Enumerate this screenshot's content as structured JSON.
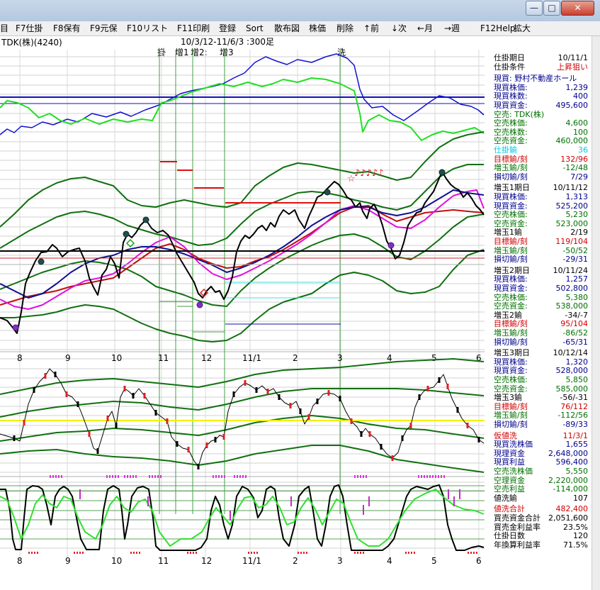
{
  "window": {
    "buttons": [
      "—",
      "□",
      "✕"
    ]
  },
  "menu": [
    "目",
    "F7仕掛",
    "F8保有",
    "F9元保",
    "F10リスト",
    "F11印刷",
    "登録",
    "Sort",
    "散布図",
    "株価",
    "削除",
    "↑前",
    "↓次",
    "←月",
    "→週",
    "F12Help",
    "拡大"
  ],
  "chart": {
    "stock": "TDK(株)(4240)",
    "range": "10/3/12-11/6/3 :300足",
    "markers": [
      "掛",
      "增1",
      "增2:",
      "增3",
      "洗"
    ],
    "x_ticks_main": [
      "8",
      "9",
      "10",
      "11",
      "12",
      "11/1",
      "2",
      "3",
      "4",
      "5",
      "6"
    ],
    "x_ticks_bottom": [
      "8",
      "9",
      "10",
      "11",
      "12",
      "11/1",
      "2",
      "3",
      "4",
      "5",
      "6"
    ],
    "notes": "♪♪♪♪♪",
    "star": "☆"
  },
  "panel": {
    "rows": [
      {
        "label": "仕掛期日",
        "value": "10/11/1",
        "color": "#000000"
      },
      {
        "label": "仕掛条件",
        "value": "上昇狙い",
        "color": "#000000",
        "vcolor": "#d00000"
      },
      {
        "label": "",
        "value": "",
        "gap": true
      },
      {
        "label": "現買: 野村不動産ホール",
        "value": "",
        "color": "#00008b"
      },
      {
        "label": "現買株価:",
        "value": "1,239",
        "color": "#00008b"
      },
      {
        "label": "現買株数:",
        "value": "400",
        "color": "#00008b"
      },
      {
        "label": "現買資金:",
        "value": "495,600",
        "color": "#00008b"
      },
      {
        "label": "空売: TDK(株)",
        "value": "",
        "color": "#007000"
      },
      {
        "label": "空売株価:",
        "value": "4,600",
        "color": "#007000"
      },
      {
        "label": "空売株数:",
        "value": "100",
        "color": "#007000"
      },
      {
        "label": "空売資金:",
        "value": "460,000",
        "color": "#007000"
      },
      {
        "label": "仕掛鍮",
        "value": "36",
        "color": "#00c8e6"
      },
      {
        "label": "目標鍮/刻",
        "value": "132/96",
        "color": "#d00000"
      },
      {
        "label": "増玉鍮/刻",
        "value": "-12/48",
        "color": "#007000"
      },
      {
        "label": "損切鍮/刻",
        "value": "7/29",
        "color": "#00008b"
      },
      {
        "label": "",
        "value": "",
        "gap": true
      },
      {
        "label": "増玉1期日",
        "value": "10/11/12",
        "color": "#000000"
      },
      {
        "label": "現買株価:",
        "value": "1,313",
        "color": "#00008b"
      },
      {
        "label": "現買資金:",
        "value": "525,200",
        "color": "#00008b"
      },
      {
        "label": "空売株価:",
        "value": "5,230",
        "color": "#007000"
      },
      {
        "label": "空売資金:",
        "value": "523,000",
        "color": "#007000"
      },
      {
        "label": "増玉1鍮",
        "value": "2/19",
        "color": "#000000"
      },
      {
        "label": "目標鍮/刻",
        "value": "119/104",
        "color": "#d00000"
      },
      {
        "label": "増玉鍮/刻",
        "value": "-50/52",
        "color": "#007000"
      },
      {
        "label": "損切鍮/刻",
        "value": "-29/31",
        "color": "#00008b"
      },
      {
        "label": "",
        "value": "",
        "gap": true
      },
      {
        "label": "増玉2期日",
        "value": "10/11/24",
        "color": "#000000"
      },
      {
        "label": "現買株価:",
        "value": "1,257",
        "color": "#00008b"
      },
      {
        "label": "現買資金:",
        "value": "502,800",
        "color": "#00008b"
      },
      {
        "label": "空売株価:",
        "value": "5,380",
        "color": "#007000"
      },
      {
        "label": "空売資金:",
        "value": "538,000",
        "color": "#007000"
      },
      {
        "label": "増玉2鍮",
        "value": "-34/-7",
        "color": "#000000"
      },
      {
        "label": "目標鍮/刻",
        "value": "95/104",
        "color": "#d00000"
      },
      {
        "label": "増玉鍮/刻",
        "value": "-86/52",
        "color": "#007000"
      },
      {
        "label": "損切鍮/刻",
        "value": "-65/31",
        "color": "#00008b"
      },
      {
        "label": "",
        "value": "",
        "gap": true
      },
      {
        "label": "増玉3期日",
        "value": "10/12/14",
        "color": "#000000"
      },
      {
        "label": "現買株価:",
        "value": "1,320",
        "color": "#00008b"
      },
      {
        "label": "現買資金:",
        "value": "528,000",
        "color": "#00008b"
      },
      {
        "label": "空売株価:",
        "value": "5,850",
        "color": "#007000"
      },
      {
        "label": "空売資金:",
        "value": "585,000",
        "color": "#007000"
      },
      {
        "label": "増玉3鍮",
        "value": "-56/-31",
        "color": "#000000"
      },
      {
        "label": "目標鍮/刻",
        "value": "76/112",
        "color": "#d00000"
      },
      {
        "label": "増玉鍮/刻",
        "value": "-112/56",
        "color": "#007000"
      },
      {
        "label": "損切鍮/刻",
        "value": "-89/33",
        "color": "#00008b"
      },
      {
        "label": "",
        "value": "",
        "gap": true
      },
      {
        "label": "仮値洗",
        "value": "11/3/1",
        "color": "#d00000"
      },
      {
        "label": "現買洗株価",
        "value": "1,655",
        "color": "#00008b"
      },
      {
        "label": "現理資金",
        "value": "2,648,000",
        "color": "#00008b"
      },
      {
        "label": "現買利益",
        "value": "596,400",
        "color": "#00008b"
      },
      {
        "label": "空売洗株価",
        "value": "5,550",
        "color": "#007000"
      },
      {
        "label": "空理資金",
        "value": "2,220,000",
        "color": "#007000"
      },
      {
        "label": "空売利益",
        "value": "-114,000",
        "color": "#007000"
      },
      {
        "label": "値洗鍮",
        "value": "107",
        "color": "#000000"
      },
      {
        "label": "",
        "value": "",
        "gap": true
      },
      {
        "label": "値洗合計",
        "value": "482,400",
        "color": "#d00000"
      },
      {
        "label": "買売資金合計",
        "value": "2,051,600",
        "color": "#000000"
      },
      {
        "label": "買売金利益率",
        "value": "23.5%",
        "color": "#000000"
      },
      {
        "label": "仕掛日数",
        "value": "120",
        "color": "#000000"
      },
      {
        "label": "年換算利益率",
        "value": "71.5%",
        "color": "#000000"
      }
    ]
  }
}
